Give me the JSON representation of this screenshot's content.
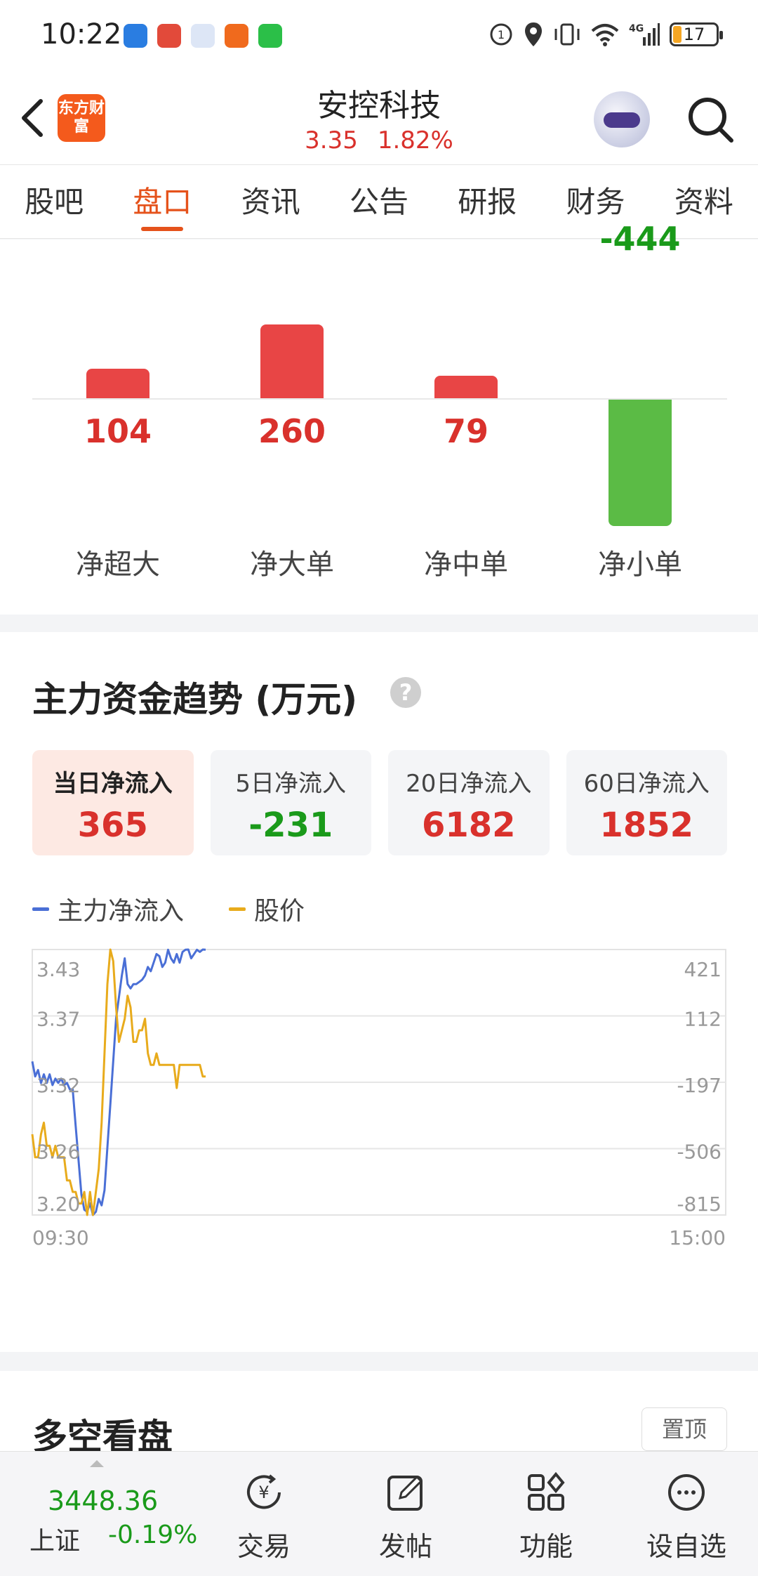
{
  "status": {
    "time": "10:22",
    "battery": "17"
  },
  "header": {
    "logo_text": "东方财富",
    "title": "安控科技",
    "price": "3.35",
    "change_pct": "1.82%"
  },
  "tabs": [
    "股吧",
    "盘口",
    "资讯",
    "公告",
    "研报",
    "财务",
    "资料"
  ],
  "active_tab": "盘口",
  "flow": {
    "colors": {
      "positive": "#e84545",
      "negative": "#5bbb45"
    },
    "items": [
      {
        "label": "净超大",
        "value": "104",
        "num": 104
      },
      {
        "label": "净大单",
        "value": "260",
        "num": 260
      },
      {
        "label": "净中单",
        "value": "79",
        "num": 79
      },
      {
        "label": "净小单",
        "value": "-444",
        "num": -444
      }
    ]
  },
  "trend": {
    "title": "主力资金趋势 (万元)",
    "help_icon": "?",
    "boxes": [
      {
        "label": "当日净流入",
        "value": "365"
      },
      {
        "label": "5日净流入",
        "value": "-231"
      },
      {
        "label": "20日净流入",
        "value": "6182"
      },
      {
        "label": "60日净流入",
        "value": "1852"
      }
    ],
    "legend": [
      {
        "name": "主力净流入",
        "color": "#4a6fd6"
      },
      {
        "name": "股价",
        "color": "#e8ab1c"
      }
    ]
  },
  "chart_data": {
    "type": "line",
    "x_range": [
      "09:30",
      "15:00"
    ],
    "xlabels": [
      "09:30",
      "15:00"
    ],
    "y_left_ticks": [
      "3.43",
      "3.37",
      "3.32",
      "3.26",
      "3.20"
    ],
    "y_right_ticks": [
      "421",
      "112",
      "-197",
      "-506",
      "-815"
    ],
    "ylim_left": [
      3.2,
      3.43
    ],
    "ylim_right": [
      -815,
      421
    ],
    "grid": true,
    "series": [
      {
        "name": "主力净流入",
        "axis": "right",
        "x": [
          0,
          1,
          2,
          3,
          4,
          5,
          6,
          7,
          8,
          9,
          10,
          11,
          12,
          13,
          14,
          15,
          16,
          17,
          18,
          19,
          20,
          21,
          22,
          23,
          24,
          25,
          26,
          27,
          28,
          29,
          30,
          31,
          32,
          33,
          34,
          35,
          36,
          37,
          38,
          39,
          40,
          41,
          42,
          43,
          44,
          45,
          46,
          47,
          48,
          49,
          50,
          51,
          52,
          53,
          54,
          55,
          56,
          57,
          58,
          59,
          60
        ],
        "values": [
          -100,
          -170,
          -140,
          -200,
          -160,
          -200,
          -160,
          -210,
          -180,
          -200,
          -180,
          -210,
          -200,
          -230,
          -230,
          -400,
          -560,
          -720,
          -790,
          -800,
          -760,
          -820,
          -800,
          -740,
          -770,
          -700,
          -500,
          -300,
          -100,
          100,
          200,
          300,
          380,
          260,
          240,
          260,
          260,
          270,
          280,
          300,
          340,
          320,
          360,
          400,
          390,
          340,
          360,
          420,
          380,
          360,
          400,
          360,
          410,
          420,
          450,
          380,
          400,
          420,
          410,
          440,
          420
        ]
      },
      {
        "name": "股价",
        "axis": "left",
        "x": [
          0,
          1,
          2,
          3,
          4,
          5,
          6,
          7,
          8,
          9,
          10,
          11,
          12,
          13,
          14,
          15,
          16,
          17,
          18,
          19,
          20,
          21,
          22,
          23,
          24,
          25,
          26,
          27,
          28,
          29,
          30,
          31,
          32,
          33,
          34,
          35,
          36,
          37,
          38,
          39,
          40,
          41,
          42,
          43,
          44,
          45,
          46,
          47,
          48,
          49,
          50,
          51,
          52,
          53,
          54,
          55,
          56,
          57,
          58,
          59,
          60
        ],
        "values": [
          3.27,
          3.25,
          3.25,
          3.27,
          3.28,
          3.26,
          3.26,
          3.25,
          3.26,
          3.25,
          3.25,
          3.25,
          3.23,
          3.23,
          3.22,
          3.22,
          3.21,
          3.21,
          3.22,
          3.2,
          3.22,
          3.2,
          3.22,
          3.24,
          3.28,
          3.34,
          3.4,
          3.45,
          3.42,
          3.38,
          3.35,
          3.36,
          3.37,
          3.39,
          3.38,
          3.35,
          3.35,
          3.36,
          3.36,
          3.37,
          3.34,
          3.33,
          3.33,
          3.34,
          3.33,
          3.33,
          3.33,
          3.33,
          3.33,
          3.33,
          3.31,
          3.33,
          3.33,
          3.33,
          3.33,
          3.33,
          3.33,
          3.33,
          3.33,
          3.32,
          3.32
        ]
      }
    ]
  },
  "section3": {
    "title": "多空看盘",
    "pin_label": "置顶"
  },
  "bottom": {
    "index_value": "3448.36",
    "index_name": "上证",
    "index_change": "-0.19%",
    "nav": [
      {
        "label": "交易",
        "icon": "trade-icon"
      },
      {
        "label": "发帖",
        "icon": "post-icon"
      },
      {
        "label": "功能",
        "icon": "apps-icon"
      },
      {
        "label": "设自选",
        "icon": "more-icon"
      }
    ]
  }
}
